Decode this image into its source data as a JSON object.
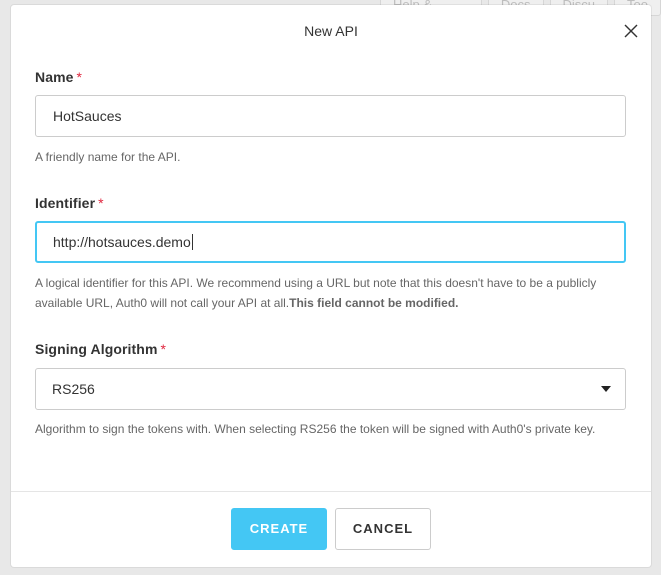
{
  "background": {
    "tabs": [
      "Help & Support",
      "Docs",
      "Discu",
      "Too"
    ]
  },
  "modal": {
    "title": "New API",
    "close_icon": "close-icon"
  },
  "fields": {
    "name": {
      "label": "Name",
      "required_mark": "*",
      "value": "HotSauces",
      "help": "A friendly name for the API."
    },
    "identifier": {
      "label": "Identifier",
      "required_mark": "*",
      "value": "http://hotsauces.demo",
      "help": "A logical identifier for this API. We recommend using a URL but note that this doesn't have to be a publicly available URL, Auth0 will not call your API at all.",
      "help_bold": "This field cannot be modified."
    },
    "signing_algorithm": {
      "label": "Signing Algorithm",
      "required_mark": "*",
      "value": "RS256",
      "help": "Algorithm to sign the tokens with. When selecting RS256 the token will be signed with Auth0's private key."
    }
  },
  "footer": {
    "create_label": "CREATE",
    "cancel_label": "CANCEL"
  },
  "colors": {
    "accent": "#44c7f4",
    "required": "#e0263e",
    "border": "#cccccc",
    "help_text": "#666666"
  }
}
